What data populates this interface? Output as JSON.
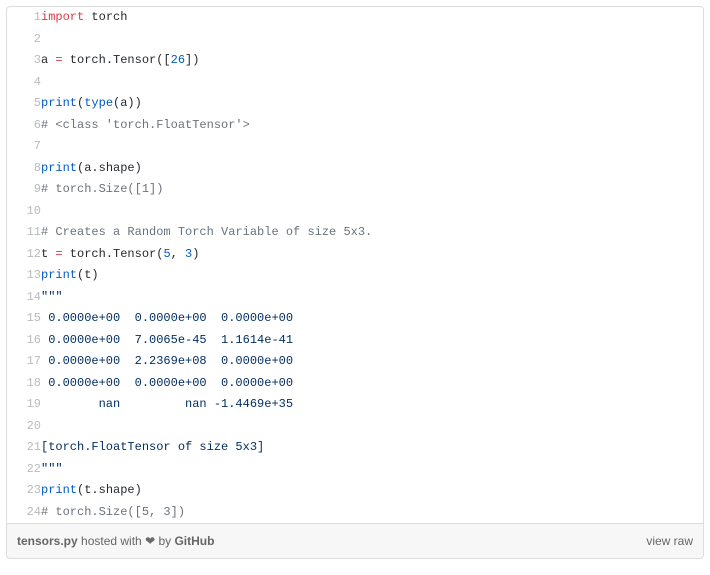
{
  "code": {
    "lines": [
      {
        "n": 1,
        "tokens": [
          {
            "t": "import ",
            "c": "tok-kw"
          },
          {
            "t": "torch",
            "c": "tok-mod"
          }
        ]
      },
      {
        "n": 2,
        "tokens": []
      },
      {
        "n": 3,
        "tokens": [
          {
            "t": "a ",
            "c": "tok-mod"
          },
          {
            "t": "=",
            "c": "tok-op"
          },
          {
            "t": " torch.Tensor([",
            "c": "tok-mod"
          },
          {
            "t": "26",
            "c": "tok-num"
          },
          {
            "t": "])",
            "c": "tok-mod"
          }
        ]
      },
      {
        "n": 4,
        "tokens": []
      },
      {
        "n": 5,
        "tokens": [
          {
            "t": "print",
            "c": "tok-fn"
          },
          {
            "t": "(",
            "c": "tok-mod"
          },
          {
            "t": "type",
            "c": "tok-fn"
          },
          {
            "t": "(a))",
            "c": "tok-mod"
          }
        ]
      },
      {
        "n": 6,
        "tokens": [
          {
            "t": "# <class 'torch.FloatTensor'>",
            "c": "tok-cmt"
          }
        ]
      },
      {
        "n": 7,
        "tokens": []
      },
      {
        "n": 8,
        "tokens": [
          {
            "t": "print",
            "c": "tok-fn"
          },
          {
            "t": "(a.shape)",
            "c": "tok-mod"
          }
        ]
      },
      {
        "n": 9,
        "tokens": [
          {
            "t": "# torch.Size([1])",
            "c": "tok-cmt"
          }
        ]
      },
      {
        "n": 10,
        "tokens": []
      },
      {
        "n": 11,
        "tokens": [
          {
            "t": "# Creates a Random Torch Variable of size 5x3.",
            "c": "tok-cmt"
          }
        ]
      },
      {
        "n": 12,
        "tokens": [
          {
            "t": "t ",
            "c": "tok-mod"
          },
          {
            "t": "=",
            "c": "tok-op"
          },
          {
            "t": " torch.Tensor(",
            "c": "tok-mod"
          },
          {
            "t": "5",
            "c": "tok-num"
          },
          {
            "t": ", ",
            "c": "tok-mod"
          },
          {
            "t": "3",
            "c": "tok-num"
          },
          {
            "t": ")",
            "c": "tok-mod"
          }
        ]
      },
      {
        "n": 13,
        "tokens": [
          {
            "t": "print",
            "c": "tok-fn"
          },
          {
            "t": "(t)",
            "c": "tok-mod"
          }
        ]
      },
      {
        "n": 14,
        "tokens": [
          {
            "t": "\"\"\"",
            "c": "tok-str"
          }
        ]
      },
      {
        "n": 15,
        "tokens": [
          {
            "t": " 0.0000e+00  0.0000e+00  0.0000e+00",
            "c": "tok-str"
          }
        ]
      },
      {
        "n": 16,
        "tokens": [
          {
            "t": " 0.0000e+00  7.0065e-45  1.1614e-41",
            "c": "tok-str"
          }
        ]
      },
      {
        "n": 17,
        "tokens": [
          {
            "t": " 0.0000e+00  2.2369e+08  0.0000e+00",
            "c": "tok-str"
          }
        ]
      },
      {
        "n": 18,
        "tokens": [
          {
            "t": " 0.0000e+00  0.0000e+00  0.0000e+00",
            "c": "tok-str"
          }
        ]
      },
      {
        "n": 19,
        "tokens": [
          {
            "t": "        nan         nan -1.4469e+35",
            "c": "tok-str"
          }
        ]
      },
      {
        "n": 20,
        "tokens": []
      },
      {
        "n": 21,
        "tokens": [
          {
            "t": "[torch.FloatTensor of size 5x3]",
            "c": "tok-str"
          }
        ]
      },
      {
        "n": 22,
        "tokens": [
          {
            "t": "\"\"\"",
            "c": "tok-str"
          }
        ]
      },
      {
        "n": 23,
        "tokens": [
          {
            "t": "print",
            "c": "tok-fn"
          },
          {
            "t": "(t.shape)",
            "c": "tok-mod"
          }
        ]
      },
      {
        "n": 24,
        "tokens": [
          {
            "t": "# torch.Size([5, 3])",
            "c": "tok-cmt"
          }
        ]
      }
    ]
  },
  "meta": {
    "filename": "tensors.py",
    "hosted_prefix": " hosted with ",
    "heart": "❤",
    "by_prefix": " by ",
    "host": "GitHub",
    "view_raw": "view raw"
  }
}
